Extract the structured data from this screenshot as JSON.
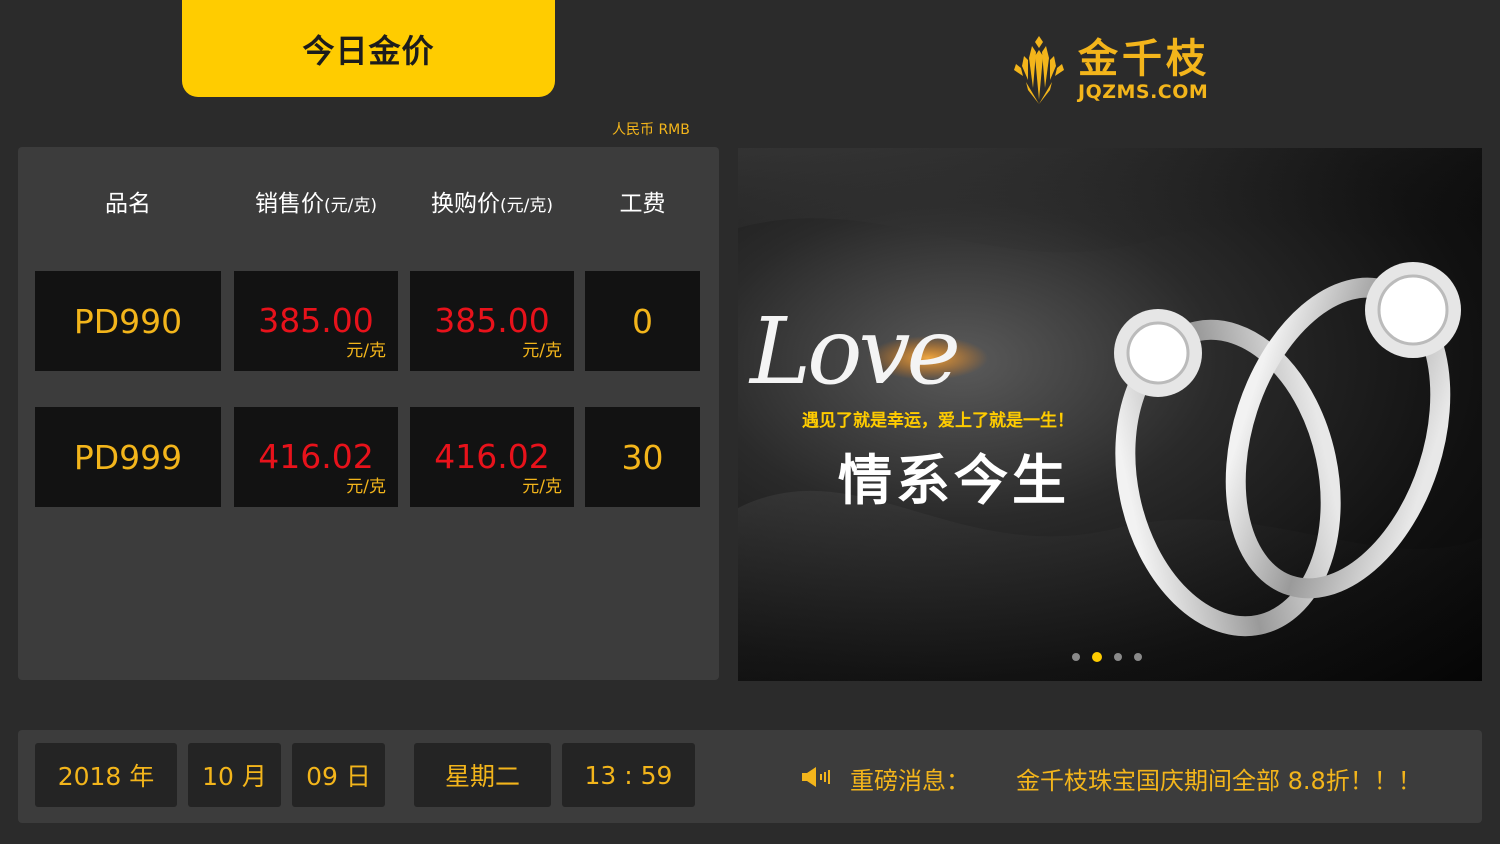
{
  "header": {
    "title": "今日金价",
    "brand_name": "金千枝",
    "brand_domain": "JQZMS.COM",
    "currency": "人民币  RMB"
  },
  "table": {
    "columns": [
      {
        "label": "品名",
        "unit": ""
      },
      {
        "label": "销售价",
        "unit": "(元/克)"
      },
      {
        "label": "换购价",
        "unit": "(元/克)"
      },
      {
        "label": "工费",
        "unit": ""
      }
    ],
    "rows": [
      {
        "name": "PD990",
        "sale": "385.00",
        "sale_unit": "元/克",
        "exchange": "385.00",
        "exchange_unit": "元/克",
        "fee": "0"
      },
      {
        "name": "PD999",
        "sale": "416.02",
        "sale_unit": "元/克",
        "exchange": "416.02",
        "exchange_unit": "元/克",
        "fee": "30"
      }
    ]
  },
  "banner": {
    "script_text": "Love",
    "slogan_small": "遇见了就是幸运，爱上了就是一生！",
    "slogan_big": "情系今生",
    "dot_count": 4,
    "active_dot": 2
  },
  "footer": {
    "year": "2018 年",
    "month": "10 月",
    "day": "09 日",
    "weekday": "星期二",
    "time": "13 : 59",
    "news_label": "重磅消息：",
    "news_text": "金千枝珠宝国庆期间全部 8.8折！！！"
  },
  "colors": {
    "background": "#2b2b2b",
    "panel": "#3c3c3c",
    "accent_yellow": "#ffcc00",
    "gold_text": "#f3b51b",
    "price_red": "#e8121b",
    "cell_bg": "#121212"
  },
  "icons": {
    "brand": "wheat-logo-icon",
    "speaker": "speaker-icon"
  }
}
